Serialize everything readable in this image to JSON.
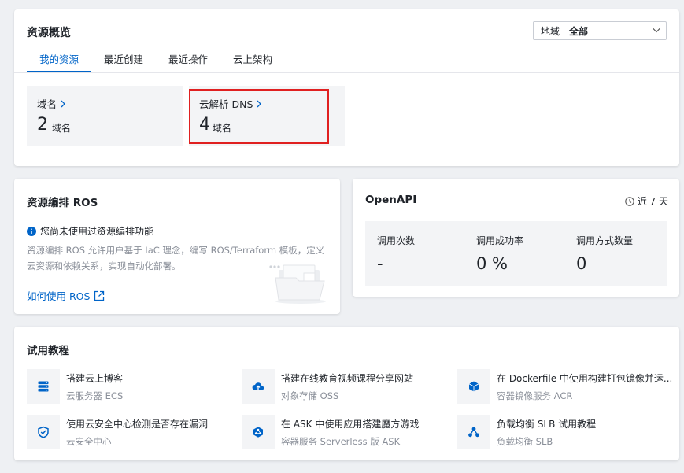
{
  "overview": {
    "title": "资源概览",
    "region": {
      "label": "地域",
      "value": "全部"
    },
    "tabs": [
      "我的资源",
      "最近创建",
      "最近操作",
      "云上架构"
    ],
    "active_tab": 0,
    "stats": [
      {
        "name": "域名",
        "count": "2",
        "unit": "域名"
      },
      {
        "name": "云解析 DNS",
        "count": "4",
        "unit": "域名"
      }
    ]
  },
  "ros": {
    "title": "资源编排 ROS",
    "info": "您尚未使用过资源编排功能",
    "description": "资源编排 ROS 允许用户基于 IaC 理念，编写 ROS/Terraform 模板，定义云资源和依赖关系，实现自动化部署。",
    "link": "如何使用 ROS"
  },
  "openapi": {
    "title": "OpenAPI",
    "range": "近 7 天",
    "stats": [
      {
        "label": "调用次数",
        "value": "-"
      },
      {
        "label": "调用成功率",
        "value": "0 %"
      },
      {
        "label": "调用方式数量",
        "value": "0"
      }
    ]
  },
  "tutorials": {
    "title": "试用教程",
    "items": [
      {
        "name": "搭建云上博客",
        "service": "云服务器 ECS",
        "icon": "server-icon"
      },
      {
        "name": "搭建在线教育视频课程分享网站",
        "service": "对象存储 OSS",
        "icon": "cloud-upload-icon"
      },
      {
        "name": "在 Dockerfile 中使用构建打包镜像并运...",
        "service": "容器镜像服务 ACR",
        "icon": "cube-icon"
      },
      {
        "name": "使用云安全中心检测是否存在漏洞",
        "service": "云安全中心",
        "icon": "shield-icon"
      },
      {
        "name": "在 ASK 中使用应用搭建魔方游戏",
        "service": "容器服务 Serverless 版 ASK",
        "icon": "cluster-icon"
      },
      {
        "name": "负载均衡 SLB 试用教程",
        "service": "负载均衡 SLB",
        "icon": "load-balancer-icon"
      }
    ]
  },
  "colors": {
    "accent": "#0064c8",
    "highlight": "#e02020",
    "muted_text": "#8a8f99",
    "panel_bg": "#f3f4f6"
  }
}
